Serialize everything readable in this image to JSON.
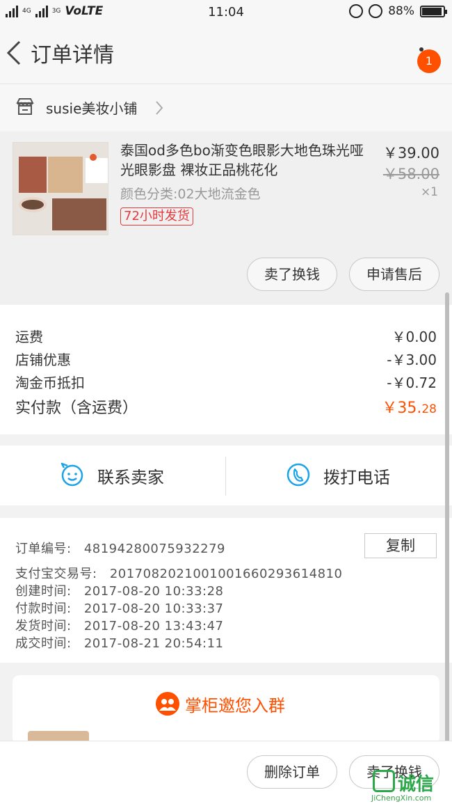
{
  "status_bar": {
    "network_left": "4G",
    "network_right": "3G",
    "carrier": "VoLTE",
    "time": "11:04",
    "battery": "88%",
    "battery_level": 0.88
  },
  "header": {
    "title": "订单详情",
    "badge_count": "1"
  },
  "shop": {
    "name": "susie美妆小铺"
  },
  "product": {
    "title": "泰国od多色bo渐变色眼影大地色珠光哑光眼影盘 裸妆正品桃花化",
    "sku": "颜色分类:02大地流金色",
    "tag": "72小时发货",
    "price": "￥39.00",
    "original_price": "￥58.00",
    "quantity": "×1",
    "buttons": {
      "resell": "卖了换钱",
      "after_sale": "申请售后"
    }
  },
  "fees": {
    "shipping_label": "运费",
    "shipping_value": "￥0.00",
    "shop_discount_label": "店铺优惠",
    "shop_discount_value": "-￥3.00",
    "coins_label": "淘金币抵扣",
    "coins_value": "-￥0.72",
    "total_label": "实付款（含运费）",
    "total_main": "￥35.",
    "total_cents": "28"
  },
  "contact": {
    "seller_label": "联系卖家",
    "phone_label": "拨打电话"
  },
  "order_info": {
    "copy_label": "复制",
    "rows": [
      {
        "label": "订单编号:",
        "value": "48194280075932279"
      },
      {
        "label": "支付宝交易号:",
        "value": "2017082021001001660293614810"
      },
      {
        "label": "创建时间:",
        "value": "2017-08-20 10:33:28"
      },
      {
        "label": "付款时间:",
        "value": "2017-08-20 10:33:37"
      },
      {
        "label": "发货时间:",
        "value": "2017-08-20 13:43:47"
      },
      {
        "label": "成交时间:",
        "value": "2017-08-21 20:54:11"
      }
    ]
  },
  "group": {
    "title": "掌柜邀您入群"
  },
  "bottom_bar": {
    "delete_label": "删除订单",
    "resell_label": "卖了换钱"
  },
  "watermark": {
    "brand": "诚信",
    "url": "JiChengXin.com"
  },
  "colors": {
    "accent": "#ff5000",
    "tag_red": "#e4393c",
    "icon_blue": "#1aa3e8",
    "watermark_green": "#2aa84a"
  }
}
